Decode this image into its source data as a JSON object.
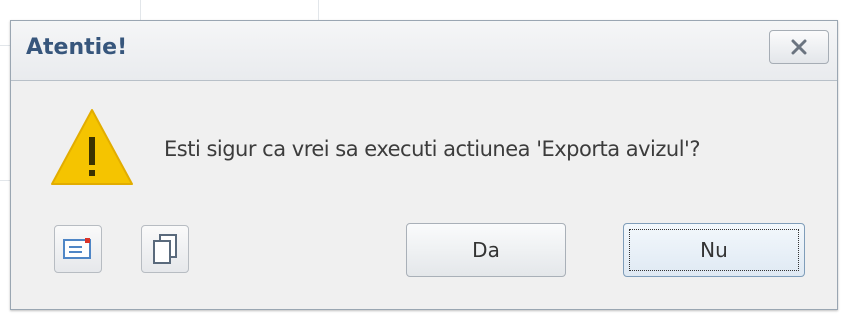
{
  "dialog": {
    "title": "Atentie!",
    "message": "Esti sigur ca vrei sa executi actiunea 'Exporta avizul'?",
    "icon": "warning-icon",
    "buttons": {
      "yes_label": "Da",
      "no_label": "Nu"
    },
    "tool_buttons": [
      "email-icon",
      "copy-icon"
    ],
    "close_icon": "close-icon"
  },
  "colors": {
    "title": "#37567c",
    "warning": "#f5c400",
    "dialog_bg": "#f0f0f0"
  }
}
